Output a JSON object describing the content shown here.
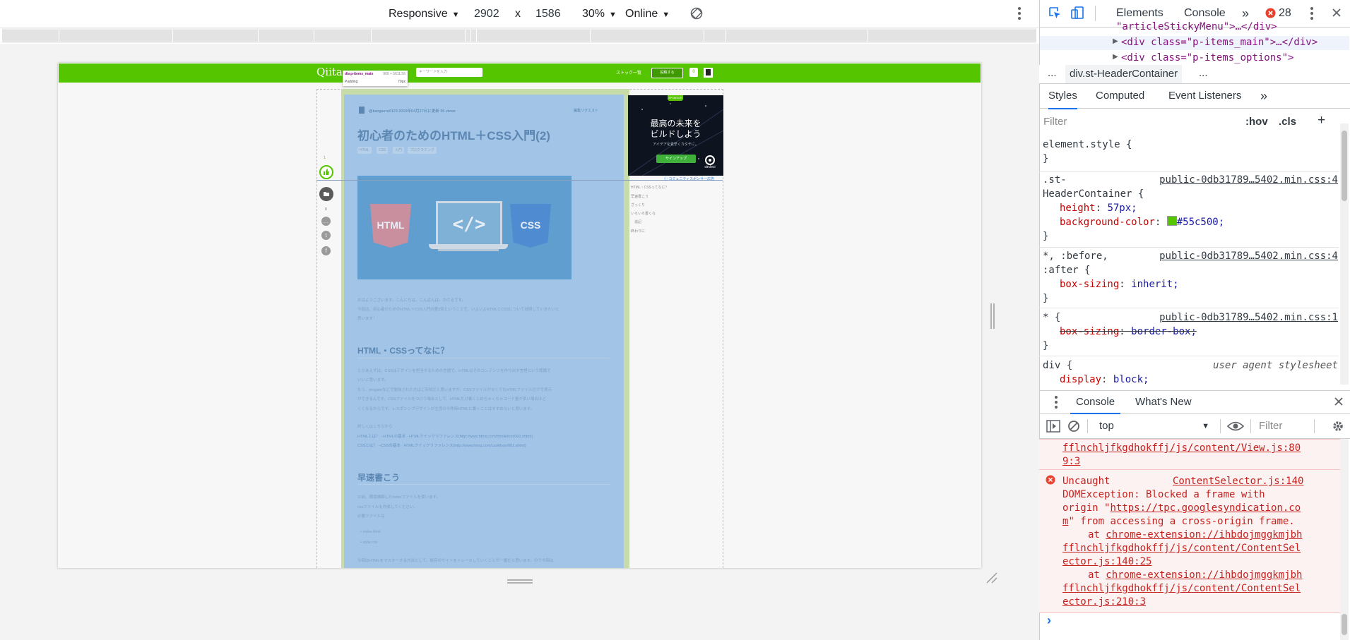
{
  "device_toolbar": {
    "device": "Responsive",
    "width": "2902",
    "times": "x",
    "height": "1586",
    "zoom": "30%",
    "throttle": "Online"
  },
  "qiita": {
    "logo": "Qiita",
    "search_placeholder": "キーワードを入力",
    "stock_link": "ストック一覧",
    "post_button": "投稿する",
    "tooltip_selector": "div.p-items_main",
    "tooltip_size": "900 × 5611.56",
    "tooltip_padding_label": "Padding",
    "tooltip_padding_value": "70px",
    "likes_count": "1",
    "comments_count": "0",
    "author_line": "@kangaeru0123   2019年04月27日に更新   36 views",
    "edit_request": "編集リクエスト",
    "article_title": "初心者のためのHTML＋CSS入門(2)",
    "tags": [
      "HTML",
      "CSS",
      "入門",
      "プログラミング"
    ],
    "hero": {
      "html": "HTML",
      "code": "</>",
      "css": "CSS"
    },
    "intro_lines": [
      "おはようございます。こんにちは。こんばんは。かけるです。",
      "今回は、初心者のためのHTML＋CSS入門の第2回ということで、いよいよHTMLとCSSについて说明していきたいと",
      "思います！"
    ],
    "section1_title": "HTML・CSSってなに？",
    "section1_lines": [
      "とりあえずは、CSSはデザインを担当するための言語で、HTMLはそのコンテンツを作り出す言語という認識で",
      "いいと思います。",
      "もう、progateなどで勉強された方はご存知だと思いますが、CSSファイルがなくてもHTMLファイルだけで表示",
      "ができるんです。CSSファイルをつけう場合として、HTMLだけ書くとめちゃくちゃコード量が多い場合ほど",
      "くくなるからです。レスポンシブデザインが主流の今昨時HTMLに書くことはすすめないと思います。"
    ],
    "section1_more": "詳しくはこちらから",
    "section1_links": [
      "HTMLとは？ --HTMLの基本 · HTMLクイックリファレンス(http://www.htmq.com/htmlkihon/001.shtml)",
      "CSSとは？ --CSSの基本 · HTMLクイックリファレンス(http://www.htmq.com/csskihon/001.shtml)"
    ],
    "section2_title": "早速書こう",
    "section2_lines": [
      "以前、環境構築したindexファイルを使います。",
      "cssファイルも作成してください。",
      "必要ファイルは"
    ],
    "section2_bullets": [
      "index.html",
      "style.css"
    ],
    "section2_tail": "今回はHTMLをマスターする方法として、既存のサイトをトレースしていくことが一番だと思います。ので今回は",
    "ad": {
      "badge": "SPONSOR",
      "title_line1": "最高の未来を",
      "title_line2": "ビルドしよう",
      "subtitle": "アイデアを素早くカタチに。",
      "button": "サインアップ",
      "logo": "circleci",
      "sponsor_note": "コミュニティスポンサー広告"
    },
    "toc": [
      "HTML・CSSってなに？",
      "早速書こう",
      "ざっくり",
      "いろいろ書くな",
      "追記",
      "終わりに"
    ]
  },
  "devtools": {
    "tabs": [
      "Elements",
      "Console"
    ],
    "more_tabs": "»",
    "error_count": "28",
    "dom_lines": [
      "\"articleStickyMenu\">…</div>",
      "<div class=\"p-items_main\">…</div>",
      "<div class=\"p-items_options\">"
    ],
    "breadcrumb": "div.st-HeaderContainer",
    "breadcrumb_ellipsis": "...",
    "styles_tabs": [
      "Styles",
      "Computed",
      "Event Listeners"
    ],
    "styles_more": "»",
    "filter_placeholder": "Filter",
    "hov": ":hov",
    "cls": ".cls",
    "plus": "+",
    "rules": {
      "element_style": "element.style {",
      "close": "}",
      "r1_selector_a": ".st-",
      "r1_selector_b": "HeaderContainer {",
      "r1_source": "public-0db31789…5402.min.css:4",
      "r1_prop1": "height",
      "r1_val1": "57px;",
      "r1_prop2": "background-color",
      "r1_val2": "#55c500;",
      "r2_selector_a": "*, :before,",
      "r2_selector_b": ":after {",
      "r2_source": "public-0db31789…5402.min.css:4",
      "r2_prop": "box-sizing",
      "r2_val": "inherit;",
      "r3_selector": "* {",
      "r3_source": "public-0db31789…5402.min.css:1",
      "r3_prop": "box-sizing",
      "r3_val": "border-box;",
      "r4_selector": "div {",
      "r4_source": "user agent stylesheet",
      "r4_prop": "display",
      "r4_val": "block;"
    },
    "drawer_tabs": [
      "Console",
      "What's New"
    ],
    "console_context": "top",
    "console_filter": "Filter",
    "console_lines": {
      "prev1": "fflnchljfkgdhokffj/js/content/View.js:80",
      "prev2": "9:3",
      "err_title": "Uncaught",
      "err_source": "ContentSelector.js:140",
      "msg1": "DOMException: Blocked a frame with",
      "msg2a": "origin \"",
      "msg2_link": "https://tpc.googlesyndication.co",
      "msg3_link": "m",
      "msg3b": "\" from accessing a cross-origin frame.",
      "at1_prefix": "at ",
      "at1_a": "chrome-extension://ihbdojmggkmjbh",
      "at1_b": "fflnchljfkgdhokffj/js/content/ContentSel",
      "at1_c": "ector.js:140:25",
      "at2_prefix": "at ",
      "at2_a": "chrome-extension://ihbdojmggkmjbh",
      "at2_b": "fflnchljfkgdhokffj/js/content/ContentSel",
      "at2_c": "ector.js:210:3",
      "prompt": "›"
    }
  },
  "colors": {
    "qiita_green": "#55c500",
    "highlight_blue": "#a2c4e6",
    "error_red": "#c5221f",
    "devtools_blue": "#1a73e8"
  }
}
